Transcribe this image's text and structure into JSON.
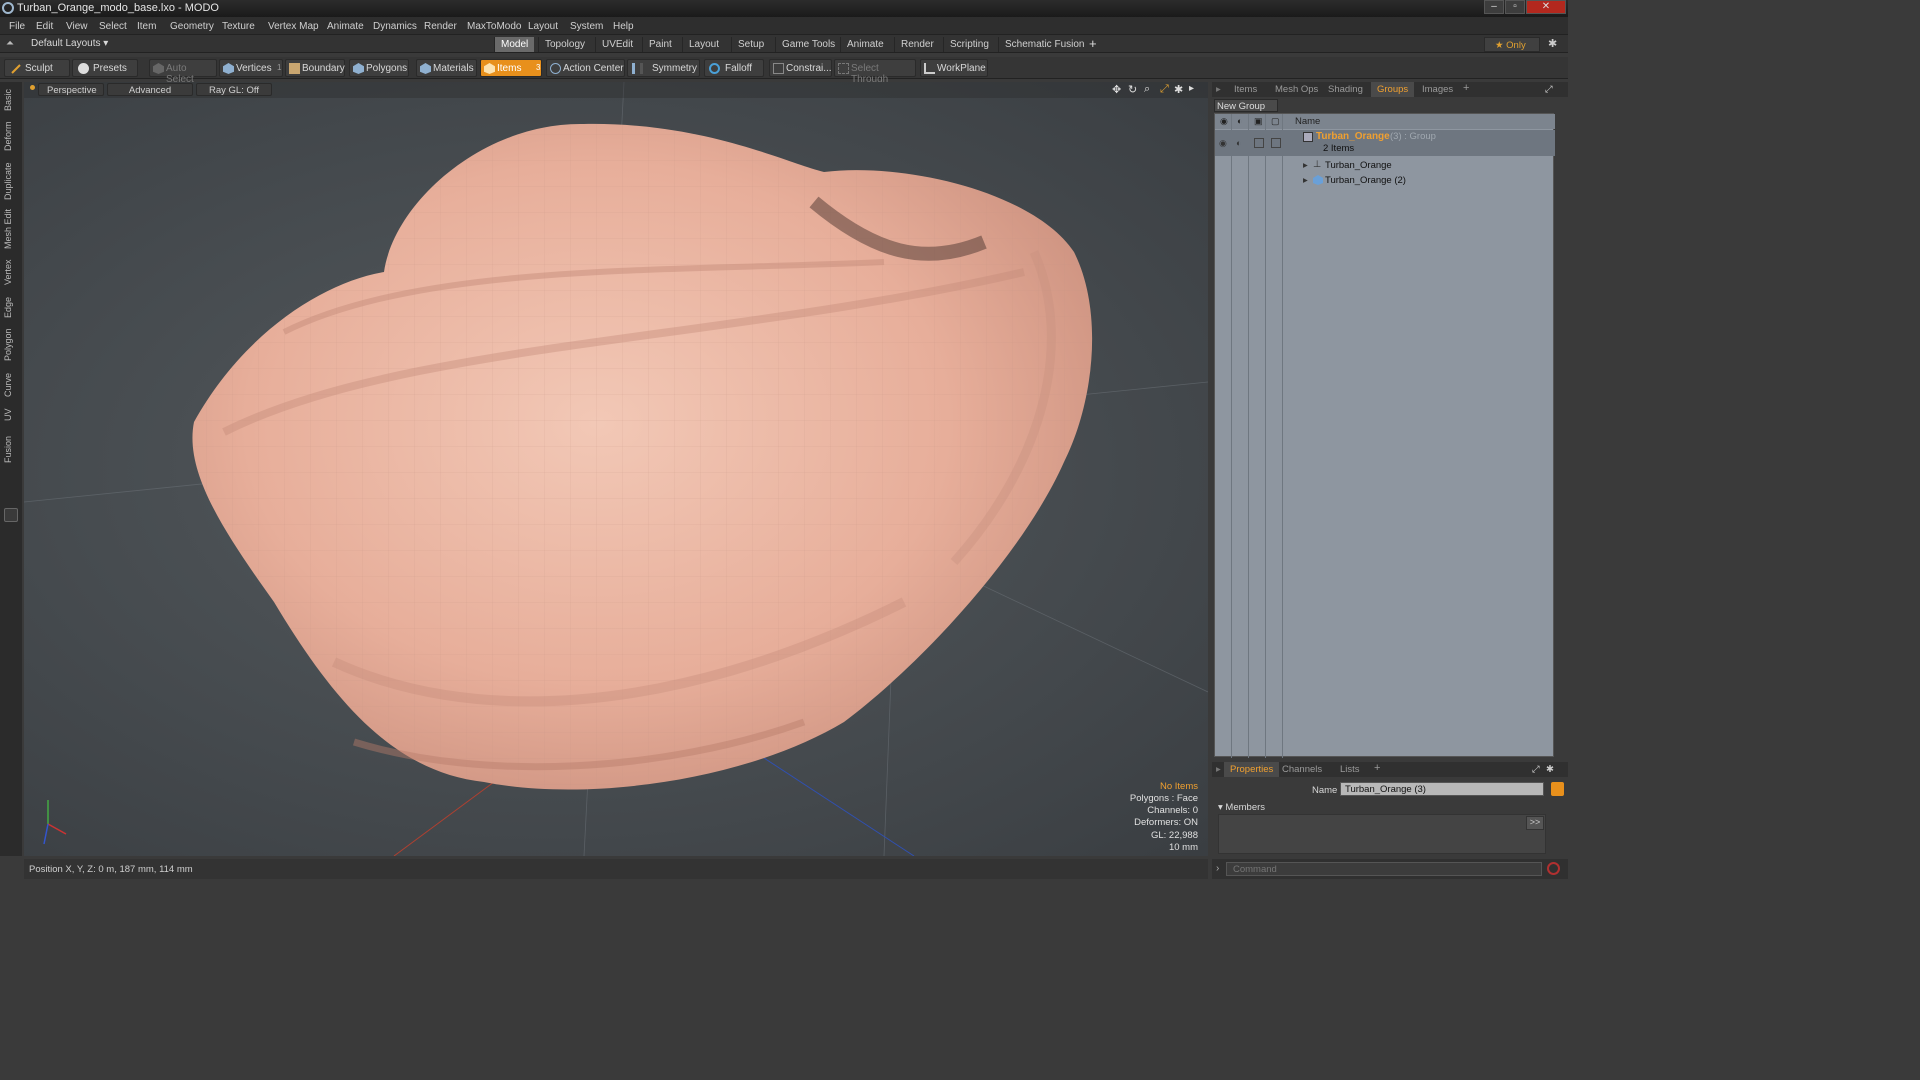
{
  "window": {
    "title": "Turban_Orange_modo_base.lxo - MODO",
    "minimize": "–",
    "maximize": "▫",
    "close": "✕"
  },
  "menu": [
    "File",
    "Edit",
    "View",
    "Select",
    "Item",
    "Geometry",
    "Texture",
    "Vertex Map",
    "Animate",
    "Dynamics",
    "Render",
    "MaxToModo",
    "Layout",
    "System",
    "Help"
  ],
  "layouts": {
    "dropdown": "Default Layouts ▾",
    "tabs": [
      "Model",
      "Topology",
      "UVEdit",
      "Paint",
      "Layout",
      "Setup",
      "Game Tools",
      "Animate",
      "Render",
      "Scripting",
      "Schematic Fusion"
    ],
    "active": "Model",
    "add": "+",
    "only": "★  Only",
    "gear": "✱"
  },
  "toolbar": {
    "sculpt": "Sculpt",
    "presets": "Presets",
    "auto_select": "Auto Select",
    "vertices": "Vertices",
    "vertices_count": "1",
    "boundary": "Boundary",
    "polygons": "Polygons",
    "materials": "Materials",
    "items": "Items",
    "items_count": "3",
    "action_center": "Action Center",
    "symmetry": "Symmetry",
    "falloff": "Falloff",
    "constraints": "Constrai...",
    "select_through": "Select Through",
    "workplane": "WorkPlane"
  },
  "left_tabs": [
    "Basic",
    "Deform",
    "Duplicate",
    "Mesh Edit",
    "Vertex",
    "Edge",
    "Polygon",
    "Curve",
    "UV",
    "Fusion"
  ],
  "viewport": {
    "view": "Perspective",
    "advanced": "Advanced",
    "raygl": "Ray GL: Off"
  },
  "viewport_info": [
    "No Items",
    "Polygons : Face",
    "Channels: 0",
    "Deformers: ON",
    "GL: 22,988",
    "10 mm"
  ],
  "status": {
    "position": "Position X, Y, Z:  0 m, 187 mm, 114 mm"
  },
  "right_tabs": [
    "Items",
    "Mesh Ops",
    "Shading",
    "Groups",
    "Images",
    "+"
  ],
  "right_active": "Groups",
  "groups": {
    "new_group": "New Group",
    "col_name": "Name",
    "group_name": "Turban_Orange",
    "group_suffix": " (3) : Group",
    "group_count": "2 Items",
    "children": [
      "Turban_Orange",
      "Turban_Orange (2)"
    ]
  },
  "props_tabs": [
    "Properties",
    "Channels",
    "Lists",
    "+"
  ],
  "props": {
    "name_label": "Name",
    "name_value": "Turban_Orange (3)",
    "members": "Members",
    "arrow": ">>"
  },
  "command": {
    "placeholder": "Command"
  }
}
